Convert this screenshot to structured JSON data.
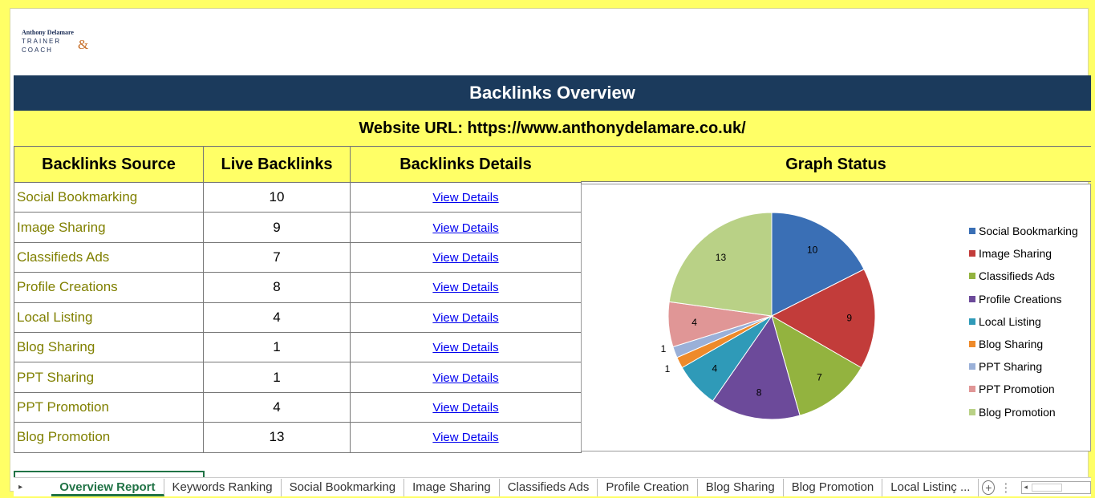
{
  "logo": {
    "name": "Anthony Delamare",
    "trainer": "TRAINER",
    "coach": "COACH",
    "amp": "&"
  },
  "title": "Backlinks Overview",
  "url_line": "Website URL: https://www.anthonydelamare.co.uk/",
  "headers": {
    "source": "Backlinks Source",
    "live": "Live Backlinks",
    "details": "Backlinks Details",
    "graph": "Graph Status"
  },
  "rows": [
    {
      "source": "Social Bookmarking",
      "live": "10",
      "details": "View Details"
    },
    {
      "source": "Image Sharing",
      "live": "9",
      "details": "View Details"
    },
    {
      "source": "Classifieds Ads",
      "live": "7",
      "details": "View Details"
    },
    {
      "source": "Profile Creations",
      "live": "8",
      "details": "View Details"
    },
    {
      "source": "Local Listing",
      "live": "4",
      "details": "View Details"
    },
    {
      "source": "Blog Sharing",
      "live": "1",
      "details": "View Details"
    },
    {
      "source": "PPT Sharing",
      "live": "1",
      "details": "View Details"
    },
    {
      "source": "PPT Promotion",
      "live": "4",
      "details": "View Details"
    },
    {
      "source": "Blog Promotion",
      "live": "13",
      "details": "View Details"
    }
  ],
  "chart_data": {
    "type": "pie",
    "categories": [
      "Social Bookmarking",
      "Image Sharing",
      "Classifieds Ads",
      "Profile Creations",
      "Local Listing",
      "Blog Sharing",
      "PPT Sharing",
      "PPT Promotion",
      "Blog Promotion"
    ],
    "values": [
      10,
      9,
      7,
      8,
      4,
      1,
      1,
      4,
      13
    ],
    "labels": [
      "10",
      "9",
      "7",
      "8",
      "4",
      "1",
      "1",
      "4",
      "13"
    ],
    "colors": [
      "#3a6fb5",
      "#c23c3a",
      "#93b33f",
      "#6c4a9a",
      "#2f9ab8",
      "#ee8a2a",
      "#9ab0d8",
      "#e09696",
      "#b9d186"
    ],
    "legend_position": "right"
  },
  "tabs": {
    "nav": "▸",
    "items": [
      "Overview Report",
      "Keywords Ranking",
      "Social Bookmarking",
      "Image Sharing",
      "Classifieds Ads",
      "Profile Creation",
      "Blog Sharing",
      "Blog Promotion",
      "Local Listinç ..."
    ],
    "active": 0,
    "add": "+",
    "more": "⋮"
  }
}
